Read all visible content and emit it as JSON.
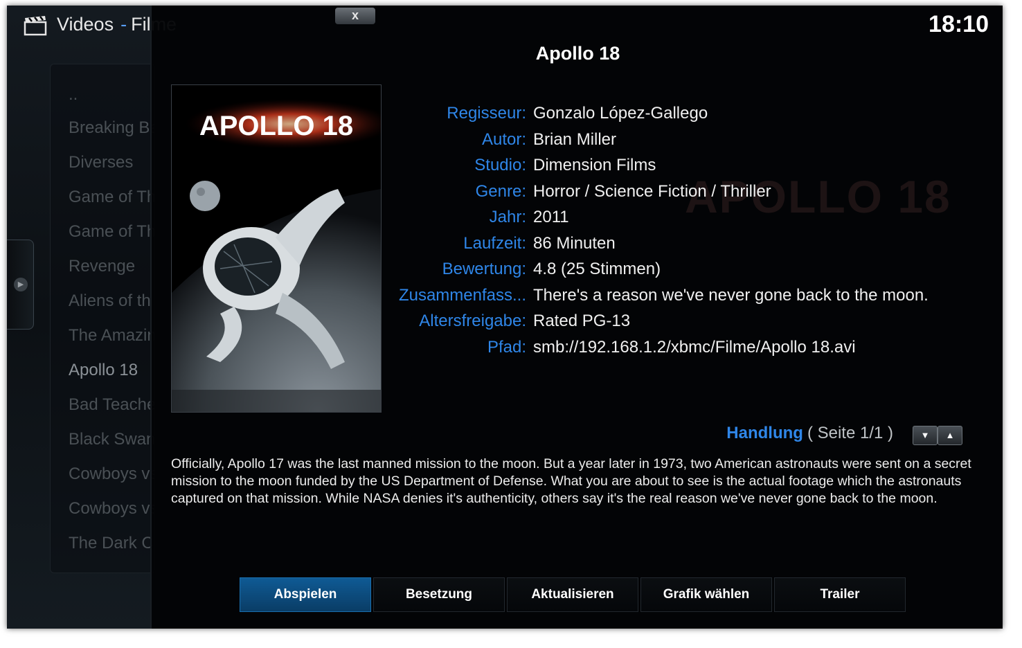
{
  "header": {
    "title": "Videos",
    "separator": "-",
    "section": "Filme",
    "clock": "18:10"
  },
  "list": {
    "items": [
      {
        "label": "..",
        "state": "dim"
      },
      {
        "label": "Breaking Ba",
        "state": "dim"
      },
      {
        "label": "Diverses",
        "state": "dim"
      },
      {
        "label": "Game of Th",
        "state": "dim"
      },
      {
        "label": "Game of Th",
        "state": "dim"
      },
      {
        "label": "Revenge",
        "state": "dim"
      },
      {
        "label": "Aliens of th",
        "state": "dim"
      },
      {
        "label": "The Amazin",
        "state": "dim"
      },
      {
        "label": "Apollo 18",
        "state": "sel"
      },
      {
        "label": "Bad Teache",
        "state": "dim"
      },
      {
        "label": "Black Swan",
        "state": "dim"
      },
      {
        "label": "Cowboys vs",
        "state": "dim"
      },
      {
        "label": "Cowboys vs",
        "state": "dim"
      },
      {
        "label": "The Dark C",
        "state": "dim"
      }
    ]
  },
  "dialog": {
    "close_label": "x",
    "title": "Apollo 18",
    "poster": {
      "alt": "APOLLO 18 poster",
      "text": "APOLLO 18"
    },
    "info": [
      {
        "label": "Regisseur:",
        "value": "Gonzalo López-Gallego"
      },
      {
        "label": "Autor:",
        "value": "Brian Miller"
      },
      {
        "label": "Studio:",
        "value": "Dimension Films"
      },
      {
        "label": "Genre:",
        "value": "Horror / Science Fiction / Thriller"
      },
      {
        "label": "Jahr:",
        "value": "2011"
      },
      {
        "label": "Laufzeit:",
        "value": "86 Minuten"
      },
      {
        "label": "Bewertung:",
        "value": "4.8 (25 Stimmen)"
      },
      {
        "label": "Zusammenfass...",
        "value": "There's a reason we've never gone back to the moon."
      },
      {
        "label": "Altersfreigabe:",
        "value": "Rated PG-13"
      },
      {
        "label": "Pfad:",
        "value": "smb://192.168.1.2/xbmc/Filme/Apollo 18.avi"
      }
    ],
    "plot": {
      "label": "Handlung",
      "page": "( Seite 1/1 )",
      "text": "Officially, Apollo 17 was the last manned mission to the moon. But a year later in 1973, two American astronauts were sent on a secret mission to the moon funded by the US Department of Defense. What you are about to see is the actual footage which the astronauts captured on that mission. While NASA denies it's authenticity, others say it's the real reason we've never gone back to the moon."
    },
    "buttons": [
      {
        "label": "Abspielen",
        "active": true
      },
      {
        "label": "Besetzung",
        "active": false
      },
      {
        "label": "Aktualisieren",
        "active": false
      },
      {
        "label": "Grafik wählen",
        "active": false
      },
      {
        "label": "Trailer",
        "active": false
      }
    ]
  },
  "colors": {
    "accent": "#2f86e8",
    "button_active": "#0f5a94",
    "background": "#06080b"
  }
}
